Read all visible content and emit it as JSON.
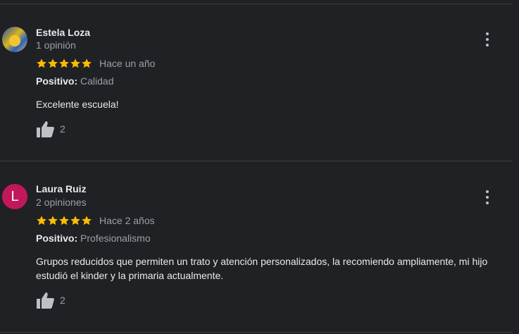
{
  "reviews": [
    {
      "name": "Estela Loza",
      "count": "1 opinión",
      "stars": 5,
      "time": "Hace un año",
      "positive_label": "Positivo:",
      "positive_value": " Calidad",
      "text": "Excelente escuela!",
      "likes": "2",
      "avatar": "photo"
    },
    {
      "name": "Laura Ruiz",
      "count": "2 opiniones",
      "stars": 5,
      "time": "Hace 2 años",
      "positive_label": "Positivo:",
      "positive_value": " Profesionalismo",
      "text": "Grupos reducidos que permiten un trato y atención personalizados, la recomiendo ampliamente, mi hijo estudió el kinder y la primaria actualmente.",
      "likes": "2",
      "avatar": "L",
      "avatar_color": "#c2185b"
    }
  ],
  "colors": {
    "star": "#fbbc04",
    "background": "#202124"
  }
}
